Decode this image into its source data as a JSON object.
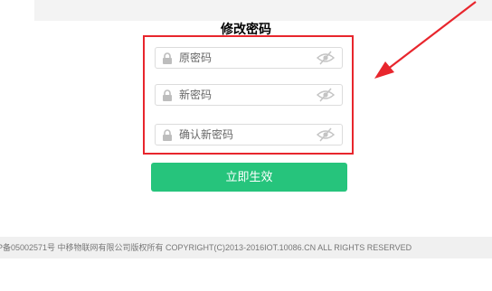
{
  "page": {
    "title": "修改密码"
  },
  "form": {
    "fields": [
      {
        "label": "原密码"
      },
      {
        "label": "新密码"
      },
      {
        "label": "确认新密码"
      }
    ],
    "submit_label": "立即生效"
  },
  "footer": {
    "text": "P备05002571号 中移物联网有限公司版权所有 COPYRIGHT(C)2013-2016IOT.10086.CN ALL RIGHTS RESERVED"
  },
  "colors": {
    "accent": "#26c47c",
    "highlight": "#e8262d"
  },
  "icons": {
    "field_left": "lock-icon",
    "field_right": "eye-slash-icon"
  }
}
